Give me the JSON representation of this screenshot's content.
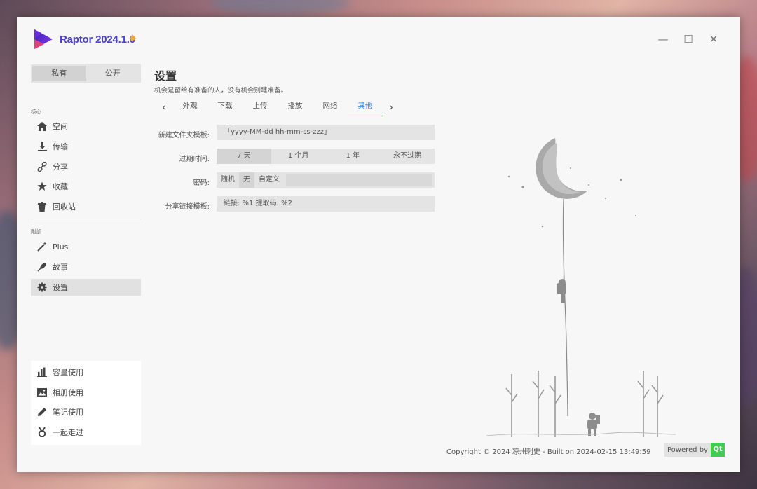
{
  "app": {
    "title": "Raptor 2024.1.0",
    "star_icon": "sparkle-icon",
    "logo_colors": [
      "#5a2ad1",
      "#e0407b",
      "#8a3cf0"
    ]
  },
  "window_controls": {
    "minimize": "—",
    "maximize": "☐",
    "close": "✕"
  },
  "sidebar": {
    "segments": [
      {
        "label": "私有",
        "active": true
      },
      {
        "label": "公开",
        "active": false
      }
    ],
    "core_section": "核心",
    "core_items": [
      {
        "label": "空间",
        "icon": "home-icon"
      },
      {
        "label": "传输",
        "icon": "download-icon"
      },
      {
        "label": "分享",
        "icon": "link-icon"
      },
      {
        "label": "收藏",
        "icon": "star-icon"
      },
      {
        "label": "回收站",
        "icon": "trash-icon"
      }
    ],
    "extra_section": "附加",
    "extra_items": [
      {
        "label": "Plus",
        "icon": "magic-wand-icon"
      },
      {
        "label": "故事",
        "icon": "feather-icon"
      },
      {
        "label": "设置",
        "icon": "gear-icon",
        "active": true
      }
    ],
    "usage_items": [
      {
        "label": "容量使用",
        "icon": "bar-chart-icon"
      },
      {
        "label": "相册使用",
        "icon": "image-icon"
      },
      {
        "label": "笔记使用",
        "icon": "pencil-icon"
      },
      {
        "label": "一起走过",
        "icon": "medal-icon"
      }
    ]
  },
  "main": {
    "title": "设置",
    "subtitle": "机会是留给有准备的人，没有机会别瞎准备。",
    "tabs": [
      {
        "label": "外观"
      },
      {
        "label": "下载"
      },
      {
        "label": "上传"
      },
      {
        "label": "播放"
      },
      {
        "label": "网络"
      },
      {
        "label": "其他",
        "active": true
      }
    ],
    "form": {
      "folder_label": "新建文件夹模板:",
      "folder_value": "「yyyy-MM-dd hh-mm-ss-zzz」",
      "expire_label": "过期时间:",
      "expire_options": [
        {
          "label": "7 天",
          "selected": true
        },
        {
          "label": "1 个月"
        },
        {
          "label": "1 年"
        },
        {
          "label": "永不过期"
        }
      ],
      "password_label": "密码:",
      "password_options": [
        {
          "label": "随机"
        },
        {
          "label": "无",
          "selected": true
        },
        {
          "label": "自定义"
        }
      ],
      "password_value": "",
      "share_label": "分享链接模板:",
      "share_value": "链接: %1 提取码: %2"
    }
  },
  "footer": {
    "copyright": "Copyright © 2024 凉州刺史 - Built on 2024-02-15 13:49:59",
    "powered_by": "Powered by",
    "qt": "Qt",
    "qt_color": "#41cd52"
  },
  "accent_color": "#2b7de9"
}
